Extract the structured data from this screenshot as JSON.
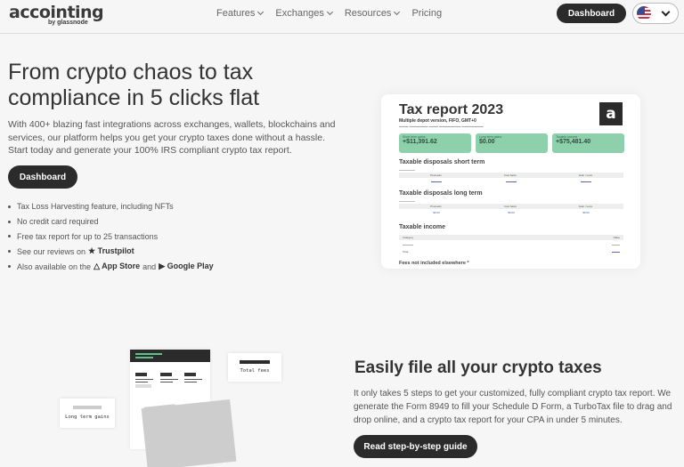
{
  "header": {
    "logo_main": "accointing",
    "logo_sub": "by glassnode",
    "nav": [
      {
        "label": "Features",
        "has_dropdown": true
      },
      {
        "label": "Exchanges",
        "has_dropdown": true
      },
      {
        "label": "Resources",
        "has_dropdown": true
      },
      {
        "label": "Pricing",
        "has_dropdown": false
      }
    ],
    "dashboard_label": "Dashboard",
    "language_icon": "us-flag-icon"
  },
  "hero": {
    "title": "From crypto chaos to tax compliance in 5 clicks flat",
    "description": "With 400+ blazing fast integrations across exchanges, wallets, blockchains and services, our platform helps you get your crypto taxes done without a hassle. Start today and generate your 100% IRS compliant crypto tax report.",
    "cta_label": "Dashboard",
    "bullets": [
      {
        "text": "Tax Loss Harvesting feature, including NFTs"
      },
      {
        "text": "No credit card required"
      },
      {
        "text": "Free tax report for up to 25 transactions"
      },
      {
        "text": "See our reviews on",
        "link_icon": "★",
        "link": "Trustpilot"
      },
      {
        "text": "Also available on the",
        "link_icon": "△",
        "link": "App Store",
        "mid": "and",
        "link2_icon": "▶",
        "link2": "Google Play"
      }
    ]
  },
  "report": {
    "title": "Tax report 2023",
    "subtitle": "Multiple depot version, FIFO, GMT+0",
    "logo_letter": "a",
    "stats": [
      {
        "label": "Short term gains",
        "value": "+$11,391.62"
      },
      {
        "label": "Long term gains",
        "value": "$0.00"
      },
      {
        "label": "Taxable income",
        "value": "+$75,481.40"
      }
    ],
    "short_term": {
      "title": "Taxable disposals short term",
      "headers": [
        "Proceeds",
        "Cost basis",
        "Gain / Loss"
      ]
    },
    "long_term": {
      "title": "Taxable disposals long term",
      "headers": [
        "Proceeds",
        "Cost basis",
        "Gain / Loss"
      ],
      "values": [
        "$0.00",
        "$0.00",
        "$0.00"
      ]
    },
    "income": {
      "title": "Taxable income",
      "headers": [
        "Category",
        "Value"
      ],
      "rows": [
        "Total"
      ]
    },
    "fees_title": "Fees not included elsewhere *"
  },
  "illustration": {
    "long_term_label": "Long term gains",
    "total_fees_label": "Total fees"
  },
  "section2": {
    "title": "Easily file all your crypto taxes",
    "description": "It only takes 5 steps to get your customized, fully compliant crypto tax report. We generate the Form 8949 to fill your Schedule D Form, a TurboTax file to drag and drop online, and a crypto tax report for your CPA in under 5 minutes.",
    "cta_label": "Read step-by-step guide"
  }
}
